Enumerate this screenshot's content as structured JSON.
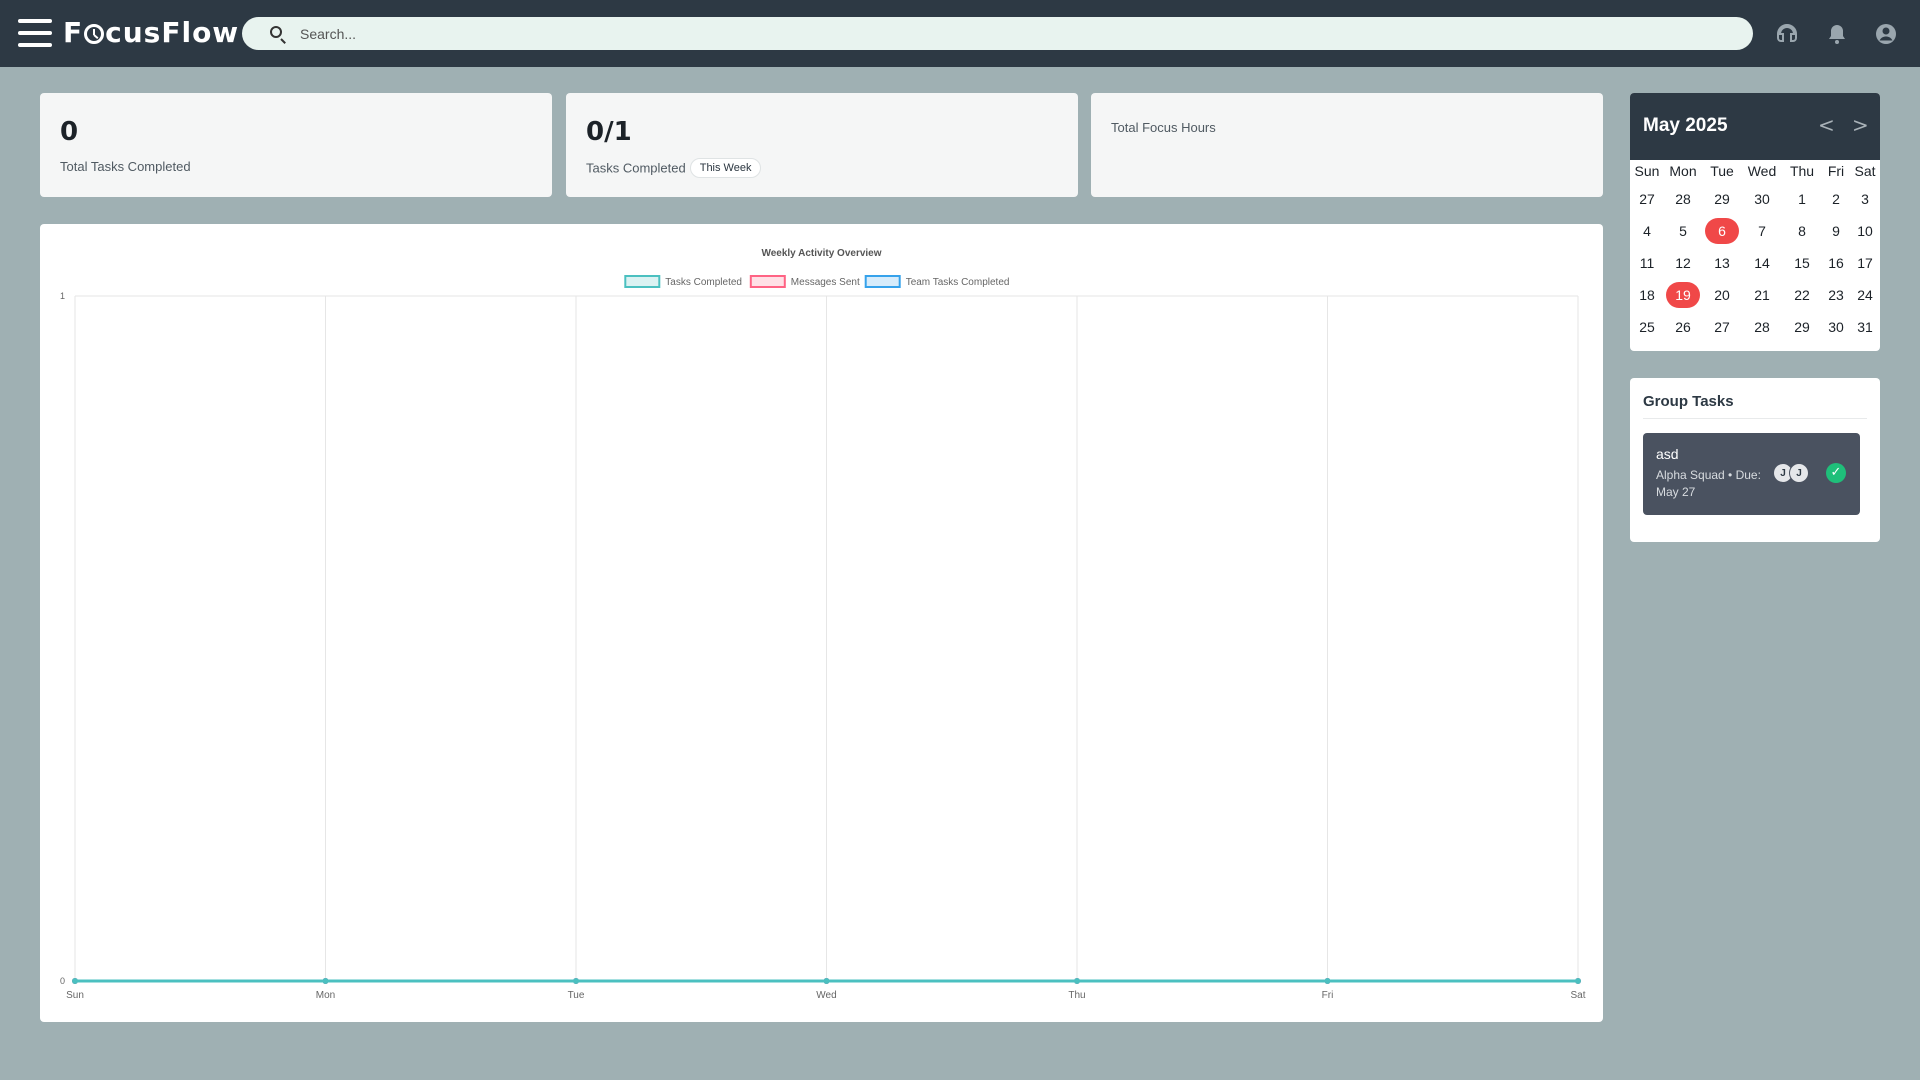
{
  "app": {
    "brand_prefix": "F",
    "brand_suffix": "cusFlow"
  },
  "search": {
    "placeholder": "Search..."
  },
  "header_icons": [
    "support-icon",
    "bell-icon",
    "account-icon"
  ],
  "stats": {
    "total_tasks": {
      "value": "0",
      "label": "Total Tasks Completed"
    },
    "weekly_tasks": {
      "value": "0/1",
      "label": "Tasks Completed",
      "badge": "This Week"
    },
    "focus_hours": {
      "label": "Total Focus Hours"
    }
  },
  "chart_data": {
    "type": "line",
    "title": "Weekly Activity Overview",
    "categories": [
      "Sun",
      "Mon",
      "Tue",
      "Wed",
      "Thu",
      "Fri",
      "Sat"
    ],
    "series": [
      {
        "name": "Tasks Completed",
        "values": [
          0,
          0,
          0,
          0,
          0,
          0,
          0
        ],
        "color": "#4bc0c0"
      },
      {
        "name": "Messages Sent",
        "values": [
          0,
          0,
          0,
          0,
          0,
          0,
          0
        ],
        "color": "#ff6384"
      },
      {
        "name": "Team Tasks Completed",
        "values": [
          0,
          0,
          0,
          0,
          0,
          0,
          0
        ],
        "color": "#36a2eb"
      }
    ],
    "ylim": [
      0,
      1
    ],
    "yticks": [
      "0",
      "1"
    ],
    "legend": "top-center",
    "grid": true
  },
  "calendar": {
    "title": "May 2025",
    "prev": "<",
    "next": ">",
    "weekdays": [
      "Sun",
      "Mon",
      "Tue",
      "Wed",
      "Thu",
      "Fri",
      "Sat"
    ],
    "weeks": [
      [
        "27",
        "28",
        "29",
        "30",
        "1",
        "2",
        "3"
      ],
      [
        "4",
        "5",
        "6",
        "7",
        "8",
        "9",
        "10"
      ],
      [
        "11",
        "12",
        "13",
        "14",
        "15",
        "16",
        "17"
      ],
      [
        "18",
        "19",
        "20",
        "21",
        "22",
        "23",
        "24"
      ],
      [
        "25",
        "26",
        "27",
        "28",
        "29",
        "30",
        "31"
      ]
    ],
    "highlighted": [
      "6",
      "19"
    ],
    "highlight_color": "#f04848"
  },
  "group_tasks": {
    "title": "Group Tasks",
    "items": [
      {
        "name": "asd",
        "meta": "Alpha Squad • Due: May 27",
        "avatars": [
          "J",
          "J"
        ],
        "done_icon": "✓"
      }
    ]
  }
}
